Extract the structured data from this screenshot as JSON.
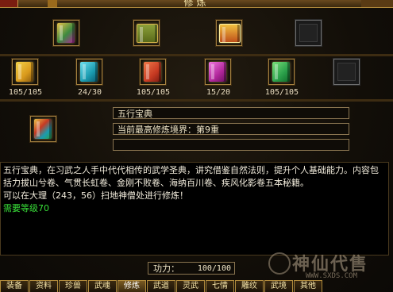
{
  "window": {
    "title": "修炼"
  },
  "top_row": [
    {
      "name": "book-bundle-icon",
      "kind": "book",
      "color": "#3d8a40"
    },
    {
      "name": "chest-icon",
      "kind": "chest",
      "color": "#6a8a2a"
    },
    {
      "name": "gold-chest-icon",
      "kind": "chest",
      "color": "#d6821a"
    },
    {
      "name": "empty-slot",
      "kind": "empty"
    }
  ],
  "manuals": [
    {
      "name": "manual-gold",
      "color": "#d99a1c",
      "count": "105/105"
    },
    {
      "name": "manual-cyan",
      "color": "#1a9bb0",
      "count": "24/30"
    },
    {
      "name": "manual-red",
      "color": "#c73a22",
      "count": "105/105"
    },
    {
      "name": "manual-purple",
      "color": "#b0259a",
      "count": "15/20"
    },
    {
      "name": "manual-green",
      "color": "#2aa04a",
      "count": "105/105"
    },
    {
      "name": "manual-empty",
      "color": "",
      "count": ""
    }
  ],
  "selected": {
    "book_name": "五行宝典",
    "realm": "当前最高修炼境界：第9重",
    "extra": ""
  },
  "description": {
    "body": "五行宝典，在习武之人手中代代相传的武学圣典，讲究借鉴自然法则，提升个人基础能力。内容包括力拔山兮卷、气贯长虹卷、金刚不败卷、海纳百川卷、疾风化影卷五本秘籍。",
    "location": "可以在大理（243，56）扫地神僧处进行修炼！",
    "requirement": "需要等级70"
  },
  "power": {
    "label": "功力：",
    "value": "100/100"
  },
  "tabs": [
    "装备",
    "资料",
    "珍兽",
    "武魂",
    "修炼",
    "武道",
    "灵武",
    "七情",
    "雕纹",
    "武境",
    "其他"
  ],
  "active_tab": 4,
  "watermark": {
    "brand": "神仙代售",
    "site": "WWW.SXDS.COM"
  },
  "colors": {
    "accent": "#b08a3c",
    "requirement": "#39e139"
  }
}
